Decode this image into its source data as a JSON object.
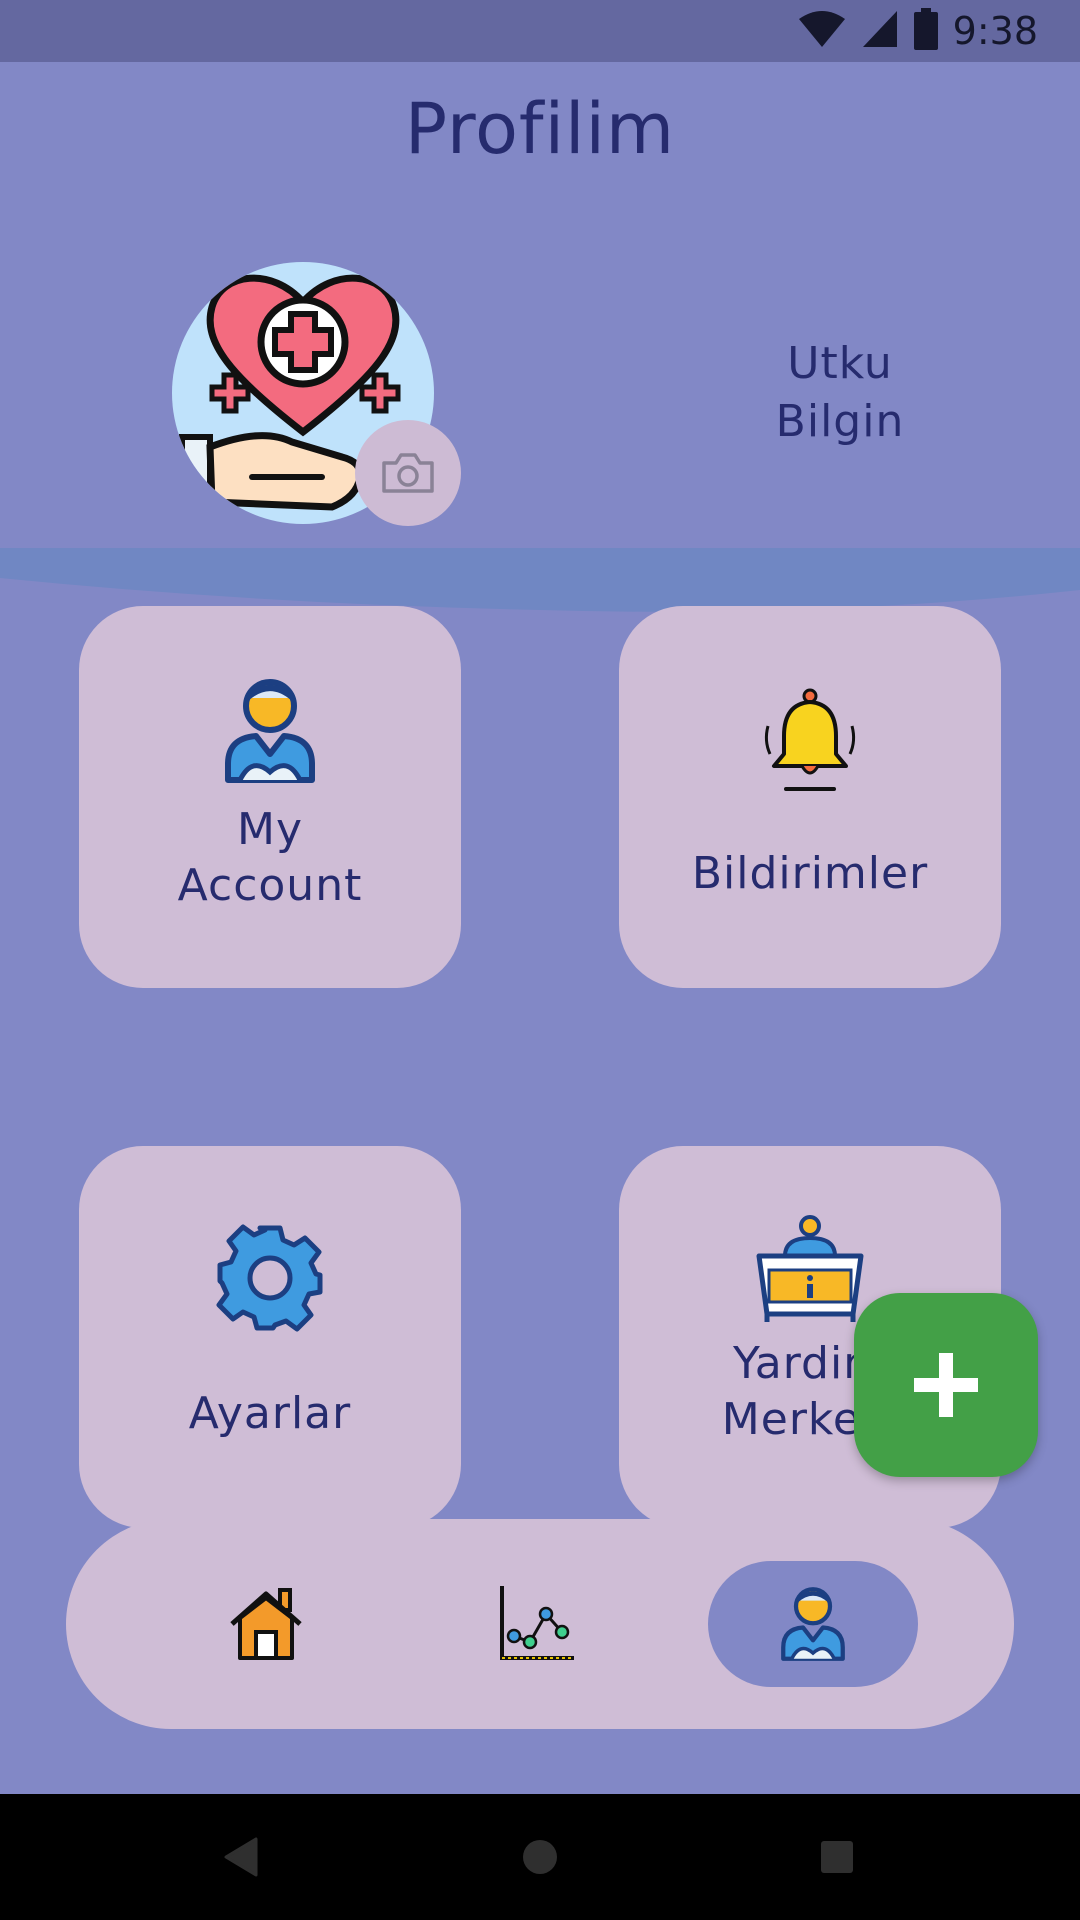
{
  "status_bar": {
    "time": "9:38",
    "icons": [
      "wifi-icon",
      "signal-icon",
      "battery-icon"
    ]
  },
  "header": {
    "title": "Profilim"
  },
  "profile": {
    "name_line1": "Utku",
    "name_line2": "Bilgin",
    "avatar_icon": "heart-medical-hand-icon",
    "camera_icon": "camera-icon"
  },
  "cards": [
    {
      "label_line1": "My",
      "label_line2": "Account",
      "icon": "user-icon"
    },
    {
      "label": "Bildirimler",
      "icon": "bell-icon"
    },
    {
      "label": "Ayarlar",
      "icon": "gear-icon"
    },
    {
      "label_line1": "Yardim",
      "label_line2": "Merkezi",
      "icon": "help-desk-icon"
    }
  ],
  "fab": {
    "icon": "plus-icon"
  },
  "bottom_nav": {
    "items": [
      {
        "icon": "home-icon",
        "active": false
      },
      {
        "icon": "chart-icon",
        "active": false
      },
      {
        "icon": "profile-icon",
        "active": true
      }
    ]
  },
  "system_nav": {
    "icons": [
      "back-icon",
      "home-circle-icon",
      "recents-icon"
    ]
  },
  "colors": {
    "background": "#8288c6",
    "card": "#cfbdd6",
    "status_bar": "#6468a0",
    "text": "#262b6e",
    "fab": "#43a047"
  }
}
